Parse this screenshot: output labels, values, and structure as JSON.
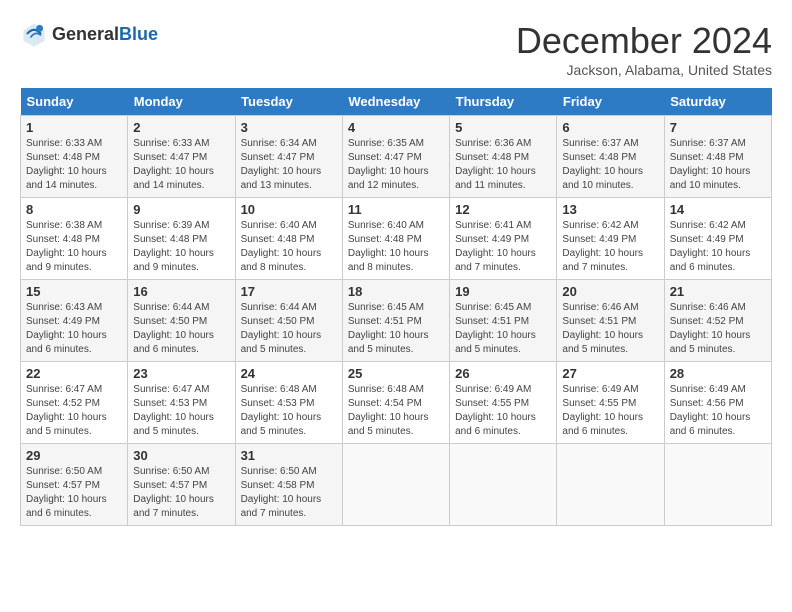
{
  "header": {
    "logo": {
      "text_general": "General",
      "text_blue": "Blue"
    },
    "title": "December 2024",
    "location": "Jackson, Alabama, United States"
  },
  "calendar": {
    "weekdays": [
      "Sunday",
      "Monday",
      "Tuesday",
      "Wednesday",
      "Thursday",
      "Friday",
      "Saturday"
    ],
    "weeks": [
      [
        {
          "day": "1",
          "info": "Sunrise: 6:33 AM\nSunset: 4:48 PM\nDaylight: 10 hours and 14 minutes."
        },
        {
          "day": "2",
          "info": "Sunrise: 6:33 AM\nSunset: 4:47 PM\nDaylight: 10 hours and 14 minutes."
        },
        {
          "day": "3",
          "info": "Sunrise: 6:34 AM\nSunset: 4:47 PM\nDaylight: 10 hours and 13 minutes."
        },
        {
          "day": "4",
          "info": "Sunrise: 6:35 AM\nSunset: 4:47 PM\nDaylight: 10 hours and 12 minutes."
        },
        {
          "day": "5",
          "info": "Sunrise: 6:36 AM\nSunset: 4:48 PM\nDaylight: 10 hours and 11 minutes."
        },
        {
          "day": "6",
          "info": "Sunrise: 6:37 AM\nSunset: 4:48 PM\nDaylight: 10 hours and 10 minutes."
        },
        {
          "day": "7",
          "info": "Sunrise: 6:37 AM\nSunset: 4:48 PM\nDaylight: 10 hours and 10 minutes."
        }
      ],
      [
        {
          "day": "8",
          "info": "Sunrise: 6:38 AM\nSunset: 4:48 PM\nDaylight: 10 hours and 9 minutes."
        },
        {
          "day": "9",
          "info": "Sunrise: 6:39 AM\nSunset: 4:48 PM\nDaylight: 10 hours and 9 minutes."
        },
        {
          "day": "10",
          "info": "Sunrise: 6:40 AM\nSunset: 4:48 PM\nDaylight: 10 hours and 8 minutes."
        },
        {
          "day": "11",
          "info": "Sunrise: 6:40 AM\nSunset: 4:48 PM\nDaylight: 10 hours and 8 minutes."
        },
        {
          "day": "12",
          "info": "Sunrise: 6:41 AM\nSunset: 4:49 PM\nDaylight: 10 hours and 7 minutes."
        },
        {
          "day": "13",
          "info": "Sunrise: 6:42 AM\nSunset: 4:49 PM\nDaylight: 10 hours and 7 minutes."
        },
        {
          "day": "14",
          "info": "Sunrise: 6:42 AM\nSunset: 4:49 PM\nDaylight: 10 hours and 6 minutes."
        }
      ],
      [
        {
          "day": "15",
          "info": "Sunrise: 6:43 AM\nSunset: 4:49 PM\nDaylight: 10 hours and 6 minutes."
        },
        {
          "day": "16",
          "info": "Sunrise: 6:44 AM\nSunset: 4:50 PM\nDaylight: 10 hours and 6 minutes."
        },
        {
          "day": "17",
          "info": "Sunrise: 6:44 AM\nSunset: 4:50 PM\nDaylight: 10 hours and 5 minutes."
        },
        {
          "day": "18",
          "info": "Sunrise: 6:45 AM\nSunset: 4:51 PM\nDaylight: 10 hours and 5 minutes."
        },
        {
          "day": "19",
          "info": "Sunrise: 6:45 AM\nSunset: 4:51 PM\nDaylight: 10 hours and 5 minutes."
        },
        {
          "day": "20",
          "info": "Sunrise: 6:46 AM\nSunset: 4:51 PM\nDaylight: 10 hours and 5 minutes."
        },
        {
          "day": "21",
          "info": "Sunrise: 6:46 AM\nSunset: 4:52 PM\nDaylight: 10 hours and 5 minutes."
        }
      ],
      [
        {
          "day": "22",
          "info": "Sunrise: 6:47 AM\nSunset: 4:52 PM\nDaylight: 10 hours and 5 minutes."
        },
        {
          "day": "23",
          "info": "Sunrise: 6:47 AM\nSunset: 4:53 PM\nDaylight: 10 hours and 5 minutes."
        },
        {
          "day": "24",
          "info": "Sunrise: 6:48 AM\nSunset: 4:53 PM\nDaylight: 10 hours and 5 minutes."
        },
        {
          "day": "25",
          "info": "Sunrise: 6:48 AM\nSunset: 4:54 PM\nDaylight: 10 hours and 5 minutes."
        },
        {
          "day": "26",
          "info": "Sunrise: 6:49 AM\nSunset: 4:55 PM\nDaylight: 10 hours and 6 minutes."
        },
        {
          "day": "27",
          "info": "Sunrise: 6:49 AM\nSunset: 4:55 PM\nDaylight: 10 hours and 6 minutes."
        },
        {
          "day": "28",
          "info": "Sunrise: 6:49 AM\nSunset: 4:56 PM\nDaylight: 10 hours and 6 minutes."
        }
      ],
      [
        {
          "day": "29",
          "info": "Sunrise: 6:50 AM\nSunset: 4:57 PM\nDaylight: 10 hours and 6 minutes."
        },
        {
          "day": "30",
          "info": "Sunrise: 6:50 AM\nSunset: 4:57 PM\nDaylight: 10 hours and 7 minutes."
        },
        {
          "day": "31",
          "info": "Sunrise: 6:50 AM\nSunset: 4:58 PM\nDaylight: 10 hours and 7 minutes."
        },
        null,
        null,
        null,
        null
      ]
    ]
  }
}
